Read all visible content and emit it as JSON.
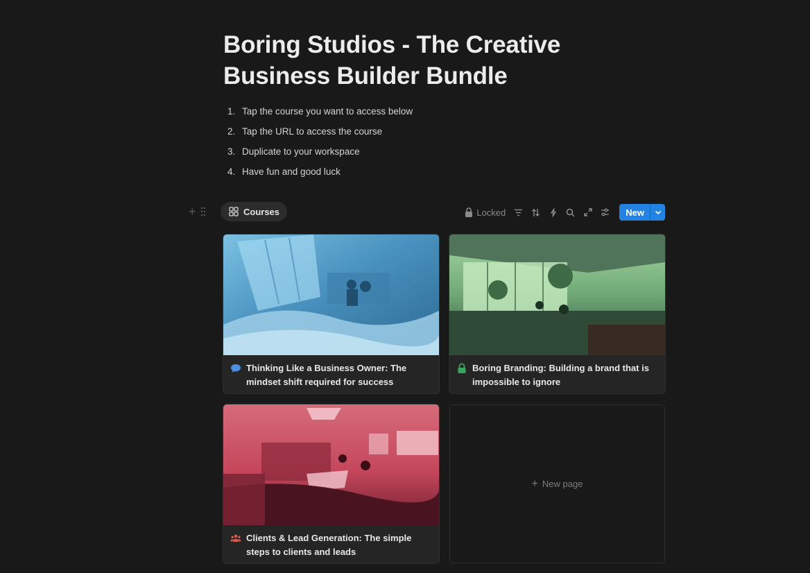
{
  "page": {
    "title": "Boring Studios - The Creative Business Builder Bundle"
  },
  "steps": [
    {
      "num": "1.",
      "text": "Tap the course you want to access below"
    },
    {
      "num": "2.",
      "text": "Tap the URL to access the course"
    },
    {
      "num": "3.",
      "text": "Duplicate to your workspace"
    },
    {
      "num": "4.",
      "text": "Have fun and good luck"
    }
  ],
  "database": {
    "view_label": "Courses",
    "view_icon": "gallery-grid-icon",
    "locked_label": "Locked",
    "new_label": "New"
  },
  "cards": [
    {
      "title": "Thinking Like a Business Owner: The mindset shift required for success",
      "icon": "speech-bubble-icon",
      "icon_color": "#4a8fe0",
      "cover_tint": "#4a92c0"
    },
    {
      "title": "Boring Branding: Building a brand that is impossible to ignore",
      "icon": "lock-icon",
      "icon_color": "#3aa55f",
      "cover_tint": "#6fa877"
    },
    {
      "title": "Clients & Lead Generation: The simple steps to clients and leads",
      "icon": "people-icon",
      "icon_color": "#e05a4f",
      "cover_tint": "#c5475c"
    }
  ],
  "new_page_label": "New page"
}
